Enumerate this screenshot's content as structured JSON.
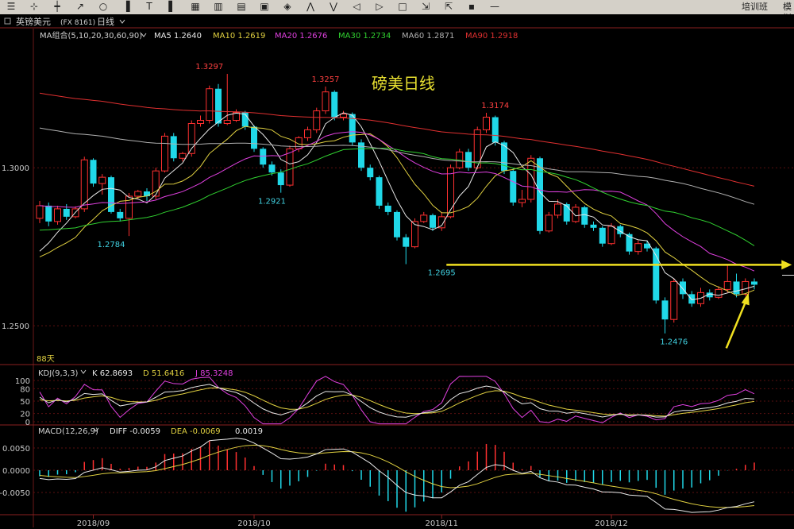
{
  "toolbar": {
    "icons": [
      "list-icon",
      "crosshair-icon",
      "candle-icon",
      "trend-icon",
      "circle-icon",
      "bars-icon",
      "t-icon",
      "bars2-icon",
      "grid-icon",
      "calendar-week-icon",
      "calendar-month-icon",
      "box-icon",
      "diamond-icon",
      "collapse-icon",
      "expand-icon",
      "left-icon",
      "right-icon",
      "window-icon",
      "shrink-icon",
      "grow-icon",
      "disk-icon",
      "minus-icon"
    ],
    "right_items": [
      "培训班",
      "模拟"
    ]
  },
  "header": {
    "symbol": "英镑美元",
    "code": "(FX 8161)",
    "period": "日线"
  },
  "ma_legend": [
    {
      "text": "MA组合(5,10,20,30,60,90)",
      "color": "#d0d0d0"
    },
    {
      "text": "MA5 1.2640",
      "color": "#e8e8e8"
    },
    {
      "text": "MA10 1.2619",
      "color": "#e0d040"
    },
    {
      "text": "MA20 1.2676",
      "color": "#e040e0"
    },
    {
      "text": "MA30 1.2734",
      "color": "#30d030"
    },
    {
      "text": "MA60 1.2871",
      "color": "#b0b0b0"
    },
    {
      "text": "MA90 1.2918",
      "color": "#e03030"
    }
  ],
  "annotation": {
    "text": "磅美日线",
    "color": "#e8e030"
  },
  "main_axis": {
    "labels": [
      "1.3000",
      "1.2500"
    ],
    "values": [
      1.3,
      1.25
    ],
    "ymin": 1.243,
    "ymax": 1.3385
  },
  "days_label": "88天",
  "price_labels": [
    {
      "text": "1.3297",
      "color": "#ff4040",
      "candle": 19,
      "value": 1.3297,
      "pos": "above"
    },
    {
      "text": "1.3257",
      "color": "#ff4040",
      "candle": 32,
      "value": 1.3257,
      "pos": "above"
    },
    {
      "text": "1.3174",
      "color": "#ff4040",
      "candle": 51,
      "value": 1.3174,
      "pos": "above"
    },
    {
      "text": "1.2784",
      "color": "#40d0e0",
      "candle": 8,
      "value": 1.2784,
      "pos": "below"
    },
    {
      "text": "1.2921",
      "color": "#40d0e0",
      "candle": 26,
      "value": 1.2921,
      "pos": "below"
    },
    {
      "text": "1.2695",
      "color": "#40d0e0",
      "candle": 45,
      "value": 1.2695,
      "pos": "below"
    },
    {
      "text": "1.2476",
      "color": "#40d0e0",
      "candle": 71,
      "value": 1.2476,
      "pos": "below"
    }
  ],
  "support_line": {
    "value": 1.2693,
    "from_candle": 45,
    "to_candle": 81,
    "color": "#f0e020"
  },
  "kdj": {
    "title": "KDJ(9,3,3)",
    "values": [
      {
        "text": "K 62.8693",
        "color": "#e8e8e8"
      },
      {
        "text": "D 51.6416",
        "color": "#e0d040"
      },
      {
        "text": "J 85.3248",
        "color": "#e040e0"
      }
    ],
    "axis_labels": [
      "100",
      "80",
      "50",
      "20",
      "0"
    ],
    "axis_values": [
      100,
      80,
      50,
      20,
      0
    ]
  },
  "macd": {
    "title": "MACD(12,26,9)",
    "values": [
      {
        "text": "DIFF -0.0059",
        "color": "#e8e8e8"
      },
      {
        "text": "DEA -0.0069",
        "color": "#e0d040"
      },
      {
        "text": "0.0019",
        "color": "#e8e8e8"
      }
    ],
    "axis_labels": [
      "0.0050",
      "0.0000",
      "-0.0050"
    ],
    "axis_values": [
      0.005,
      0,
      -0.005
    ]
  },
  "chart_data": {
    "type": "candlestick",
    "title": "",
    "x_labels": [
      {
        "text": "2018/09",
        "candle": 6
      },
      {
        "text": "2018/10",
        "candle": 24
      },
      {
        "text": "2018/11",
        "candle": 45
      },
      {
        "text": "2018/12",
        "candle": 64
      }
    ],
    "candles": [
      [
        1.284,
        1.288,
        1.2825,
        1.2895
      ],
      [
        1.288,
        1.283,
        1.2815,
        1.289
      ],
      [
        1.283,
        1.287,
        1.282,
        1.288
      ],
      [
        1.287,
        1.2845,
        1.2835,
        1.2885
      ],
      [
        1.2845,
        1.287,
        1.284,
        1.2878
      ],
      [
        1.287,
        1.3025,
        1.286,
        1.3035
      ],
      [
        1.3025,
        1.295,
        1.294,
        1.303
      ],
      [
        1.295,
        1.297,
        1.2915,
        1.298
      ],
      [
        1.297,
        1.286,
        1.2855,
        1.2975
      ],
      [
        1.286,
        1.284,
        1.283,
        1.287
      ],
      [
        1.284,
        1.291,
        1.2784,
        1.292
      ],
      [
        1.291,
        1.2925,
        1.29,
        1.293
      ],
      [
        1.2925,
        1.291,
        1.2895,
        1.2935
      ],
      [
        1.291,
        1.299,
        1.29,
        1.3
      ],
      [
        1.299,
        1.31,
        1.2985,
        1.311
      ],
      [
        1.31,
        1.303,
        1.302,
        1.311
      ],
      [
        1.303,
        1.3045,
        1.302,
        1.305
      ],
      [
        1.3045,
        1.314,
        1.3035,
        1.315
      ],
      [
        1.314,
        1.315,
        1.313,
        1.3165
      ],
      [
        1.315,
        1.325,
        1.314,
        1.326
      ],
      [
        1.325,
        1.314,
        1.313,
        1.3265
      ],
      [
        1.314,
        1.315,
        1.3135,
        1.3297
      ],
      [
        1.315,
        1.3175,
        1.3145,
        1.3185
      ],
      [
        1.3175,
        1.313,
        1.312,
        1.318
      ],
      [
        1.313,
        1.306,
        1.305,
        1.3135
      ],
      [
        1.306,
        1.301,
        1.3,
        1.3065
      ],
      [
        1.301,
        1.2985,
        1.2975,
        1.302
      ],
      [
        1.2985,
        1.2945,
        1.2921,
        1.2995
      ],
      [
        1.2945,
        1.306,
        1.294,
        1.307
      ],
      [
        1.306,
        1.3095,
        1.305,
        1.31
      ],
      [
        1.3095,
        1.312,
        1.3085,
        1.313
      ],
      [
        1.312,
        1.318,
        1.311,
        1.319
      ],
      [
        1.318,
        1.324,
        1.317,
        1.3257
      ],
      [
        1.324,
        1.316,
        1.315,
        1.3245
      ],
      [
        1.316,
        1.317,
        1.315,
        1.318
      ],
      [
        1.317,
        1.308,
        1.307,
        1.3175
      ],
      [
        1.308,
        1.3,
        1.299,
        1.309
      ],
      [
        1.3,
        1.297,
        1.296,
        1.301
      ],
      [
        1.297,
        1.288,
        1.287,
        1.2975
      ],
      [
        1.288,
        1.286,
        1.285,
        1.289
      ],
      [
        1.286,
        1.278,
        1.277,
        1.2865
      ],
      [
        1.278,
        1.275,
        1.2695,
        1.279
      ],
      [
        1.275,
        1.283,
        1.2745,
        1.284
      ],
      [
        1.283,
        1.285,
        1.2825,
        1.286
      ],
      [
        1.285,
        1.281,
        1.28,
        1.2855
      ],
      [
        1.281,
        1.2845,
        1.28,
        1.286
      ],
      [
        1.2845,
        1.3,
        1.284,
        1.301
      ],
      [
        1.3,
        1.305,
        1.2995,
        1.306
      ],
      [
        1.305,
        1.3,
        1.299,
        1.306
      ],
      [
        1.3,
        1.312,
        1.2995,
        1.313
      ],
      [
        1.312,
        1.316,
        1.311,
        1.3174
      ],
      [
        1.316,
        1.308,
        1.307,
        1.3165
      ],
      [
        1.308,
        1.299,
        1.298,
        1.3085
      ],
      [
        1.299,
        1.289,
        1.288,
        1.3
      ],
      [
        1.289,
        1.29,
        1.2875,
        1.293
      ],
      [
        1.29,
        1.303,
        1.289,
        1.304
      ],
      [
        1.303,
        1.28,
        1.279,
        1.3035
      ],
      [
        1.28,
        1.285,
        1.2795,
        1.286
      ],
      [
        1.285,
        1.2885,
        1.284,
        1.29
      ],
      [
        1.2885,
        1.283,
        1.282,
        1.289
      ],
      [
        1.283,
        1.2875,
        1.2825,
        1.2885
      ],
      [
        1.2875,
        1.282,
        1.281,
        1.288
      ],
      [
        1.282,
        1.281,
        1.28,
        1.283
      ],
      [
        1.281,
        1.276,
        1.275,
        1.2815
      ],
      [
        1.276,
        1.2815,
        1.2755,
        1.2825
      ],
      [
        1.2815,
        1.279,
        1.278,
        1.282
      ],
      [
        1.279,
        1.2735,
        1.2725,
        1.2795
      ],
      [
        1.2735,
        1.276,
        1.2725,
        1.277
      ],
      [
        1.276,
        1.2745,
        1.2735,
        1.277
      ],
      [
        1.2745,
        1.258,
        1.257,
        1.275
      ],
      [
        1.258,
        1.252,
        1.2476,
        1.259
      ],
      [
        1.252,
        1.264,
        1.251,
        1.265
      ],
      [
        1.264,
        1.26,
        1.2585,
        1.265
      ],
      [
        1.26,
        1.257,
        1.256,
        1.261
      ],
      [
        1.257,
        1.2605,
        1.256,
        1.262
      ],
      [
        1.2605,
        1.259,
        1.258,
        1.2615
      ],
      [
        1.259,
        1.2615,
        1.2585,
        1.2625
      ],
      [
        1.2615,
        1.264,
        1.2605,
        1.2693
      ],
      [
        1.264,
        1.26,
        1.259,
        1.2665
      ],
      [
        1.26,
        1.264,
        1.2595,
        1.265
      ],
      [
        1.264,
        1.263,
        1.2615,
        1.265
      ]
    ],
    "ma_colors": [
      "#e8e8e8",
      "#e0d040",
      "#e040e0",
      "#30d030",
      "#b0b0b0",
      "#e03030"
    ],
    "ma_periods": [
      5,
      10,
      20,
      30,
      60,
      90
    ],
    "ma_seed": [
      1.27,
      1.27,
      1.288,
      1.28,
      1.313,
      1.324
    ],
    "ylim": [
      1.243,
      1.3385
    ]
  }
}
